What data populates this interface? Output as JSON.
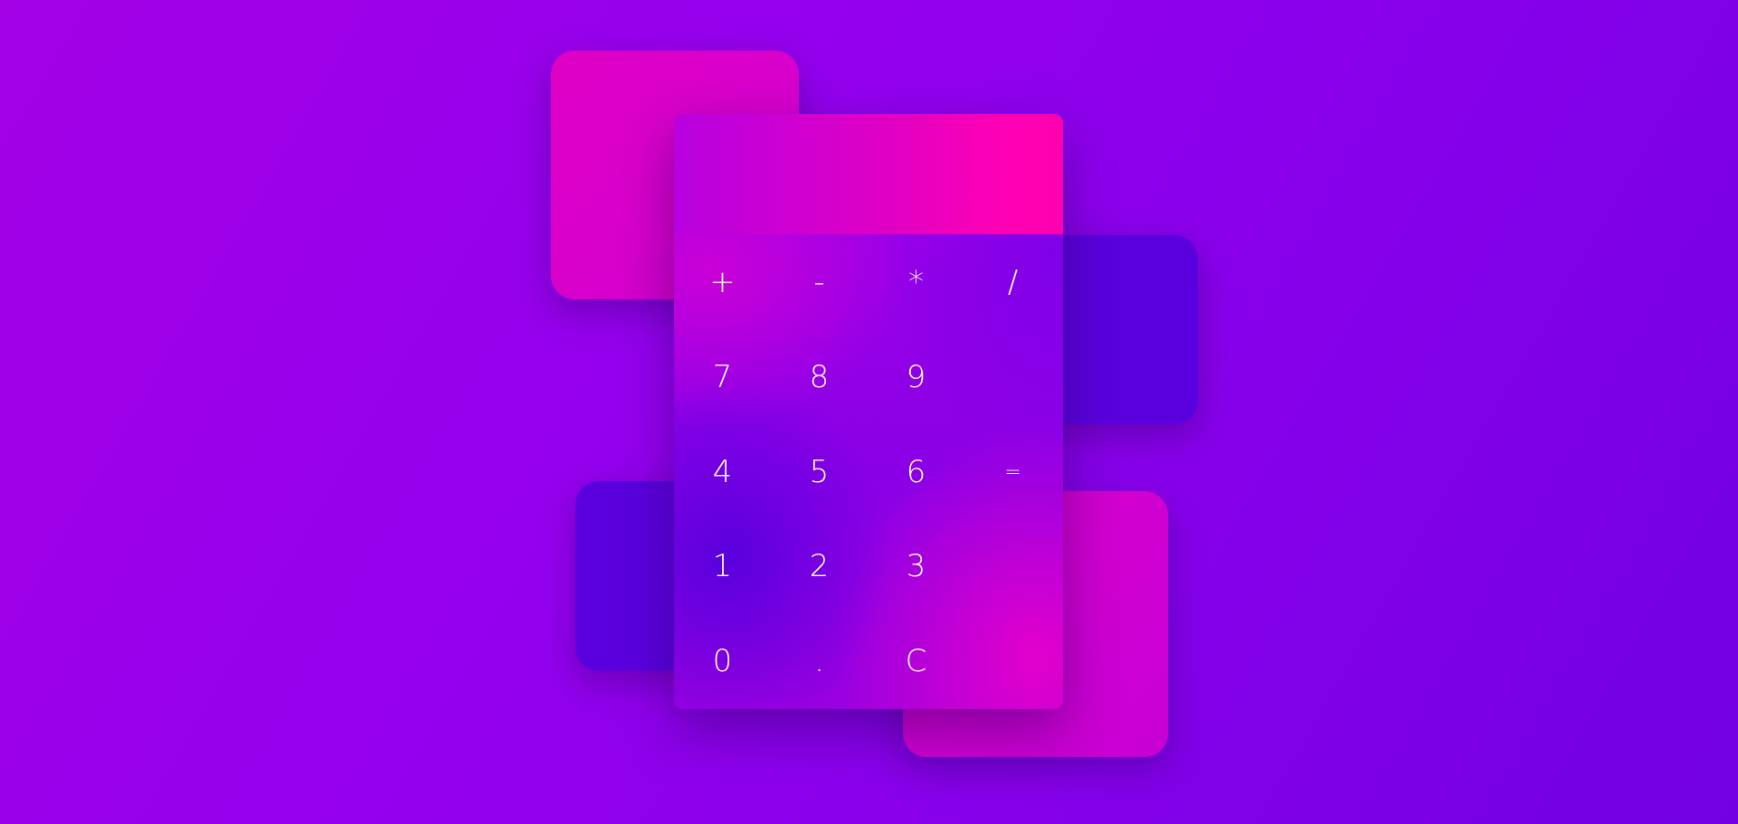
{
  "display": {
    "value": ""
  },
  "keys": {
    "plus": "+",
    "minus": "-",
    "multiply": "*",
    "divide": "/",
    "seven": "7",
    "eight": "8",
    "nine": "9",
    "four": "4",
    "five": "5",
    "six": "6",
    "one": "1",
    "two": "2",
    "three": "3",
    "equals": "=",
    "zero": "0",
    "decimal": ".",
    "clear": "C"
  },
  "colors": {
    "background": "#9400ee",
    "accent_pink": "#ff00b4",
    "accent_violet": "#5a00de",
    "text": "#ffffff"
  }
}
